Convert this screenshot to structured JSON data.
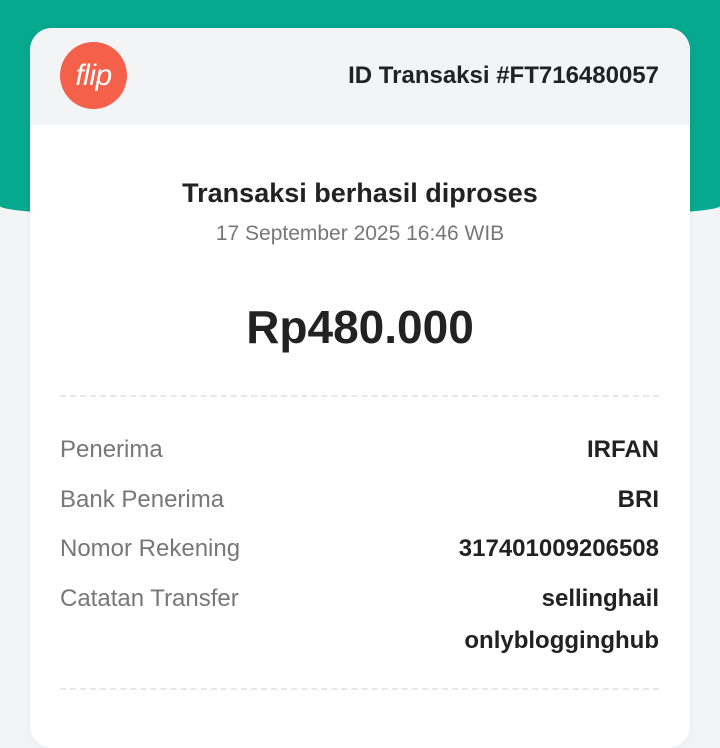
{
  "header": {
    "logo_text": "flip",
    "transaction_id": "ID Transaksi #FT716480057"
  },
  "status": {
    "title": "Transaksi berhasil diproses",
    "datetime": "17 September 2025 16:46 WIB"
  },
  "amount": "Rp480.000",
  "details": [
    {
      "label": "Penerima",
      "value": "IRFAN"
    },
    {
      "label": "Bank Penerima",
      "value": "BRI"
    },
    {
      "label": "Nomor Rekening",
      "value": "317401009206508"
    },
    {
      "label": "Catatan Transfer",
      "value": "sellinghail",
      "value_line2": "onlyblogginghub"
    }
  ],
  "colors": {
    "brand_teal": "#06a88e",
    "logo_orange": "#f4604a"
  }
}
